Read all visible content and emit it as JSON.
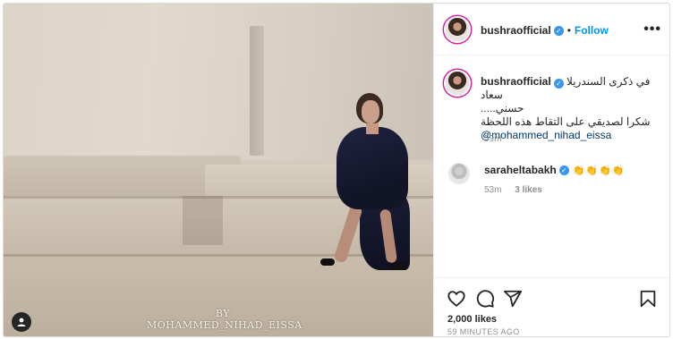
{
  "post": {
    "image": {
      "watermark_line1": "BY",
      "watermark_line2": "MOHAMMED_NIHAD_EISSA"
    },
    "header": {
      "username": "bushraofficial",
      "verified": true,
      "separator": "•",
      "follow_label": "Follow",
      "more_label": "•••"
    },
    "caption": {
      "username": "bushraofficial",
      "text_line1": "في ذكرى السندريلا سعاد",
      "text_line2": "حسني.....",
      "text_line3": "شكرا لصديقي على التقاط هذه اللحظة",
      "mention": "@mohammed_nihad_eissa",
      "time": "59m"
    },
    "comments": [
      {
        "username": "saraheltabakh",
        "verified": true,
        "text": "👏👏👏👏",
        "time": "53m",
        "likes": "3 likes"
      }
    ],
    "likes": "2,000 likes",
    "time_ago": "59 MINUTES AGO"
  },
  "icons": {
    "like": "heart-icon",
    "comment": "comment-icon",
    "share": "share-icon",
    "save": "bookmark-icon",
    "tag": "user-tag-icon",
    "verified": "verified-badge-icon"
  },
  "colors": {
    "follow": "#0095f6",
    "verified": "#3897f0",
    "mention": "#00376b",
    "muted": "#8e8e8e",
    "border": "#dbdbdb"
  }
}
